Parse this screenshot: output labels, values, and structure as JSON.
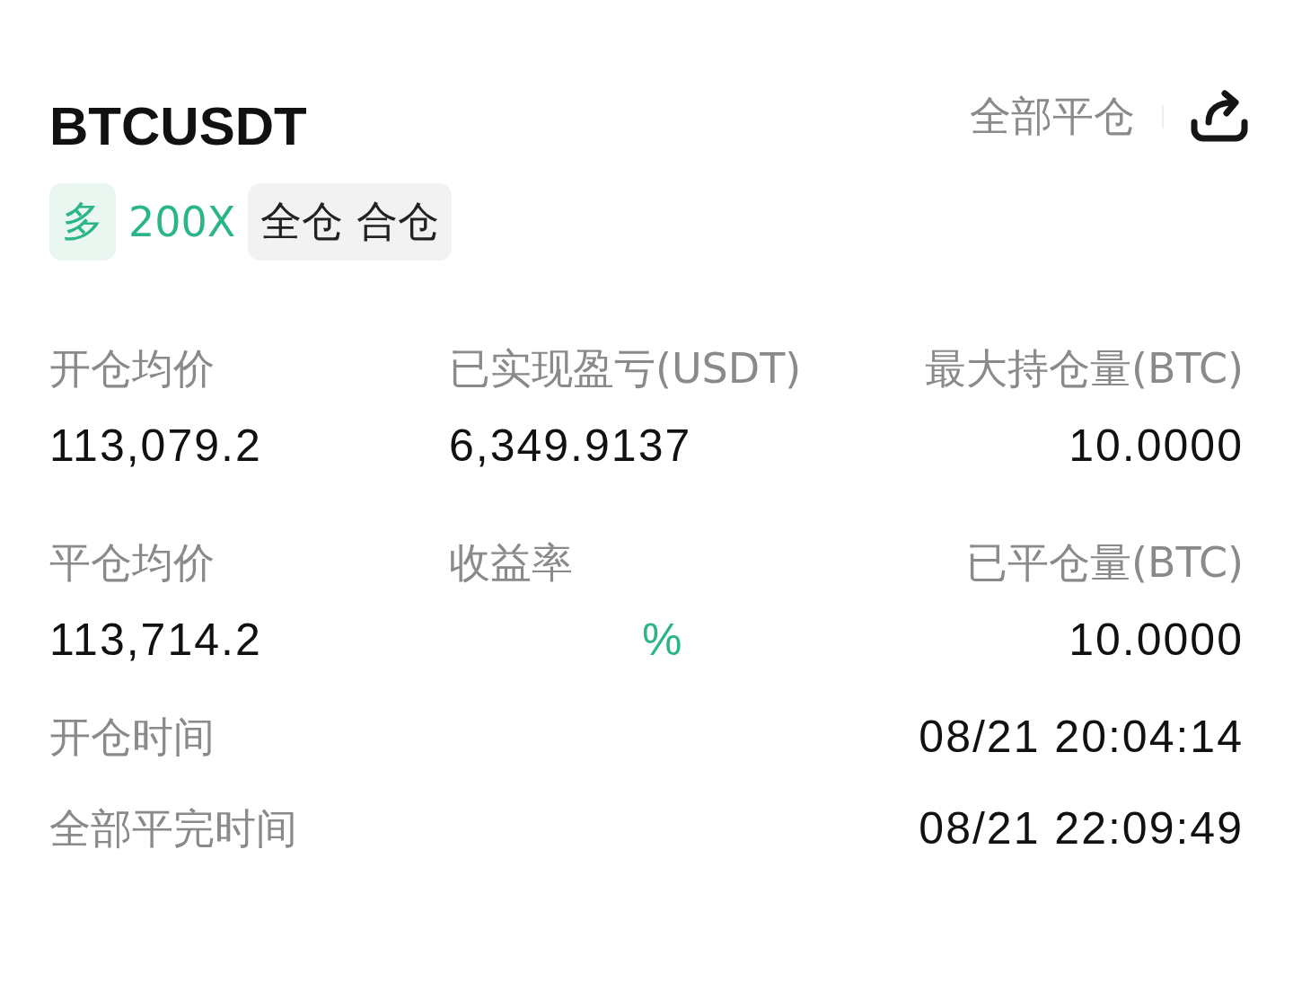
{
  "header": {
    "symbol": "BTCUSDT",
    "close_all": "全部平仓"
  },
  "tags": [
    {
      "kind": "side",
      "text": "多"
    },
    {
      "kind": "leverage",
      "text": "200X"
    },
    {
      "kind": "mode",
      "text": "全仓 合仓"
    }
  ],
  "stats": [
    {
      "label": "开仓均价",
      "value": "113,079.2",
      "kind": "plain"
    },
    {
      "label": "已实现盈亏(USDT)",
      "value": "6,349.9137",
      "kind": "plain"
    },
    {
      "label": "最大持仓量(BTC)",
      "value": "10.0000",
      "kind": "plain"
    },
    {
      "label": "平仓均价",
      "value": "113,714.2",
      "kind": "plain"
    },
    {
      "label": "收益率",
      "value": "%",
      "kind": "profit"
    },
    {
      "label": "已平仓量(BTC)",
      "value": "10.0000",
      "kind": "plain"
    }
  ],
  "times": [
    {
      "label": "开仓时间",
      "value": "08/21 20:04:14"
    },
    {
      "label": "全部平完时间",
      "value": "08/21 22:09:49"
    }
  ]
}
